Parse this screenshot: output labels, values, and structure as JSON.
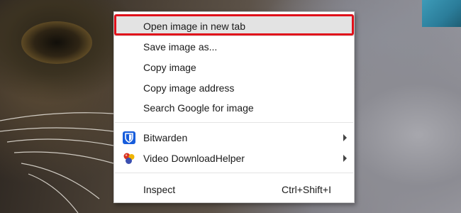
{
  "menu": {
    "items": [
      {
        "label": "Open image in new tab",
        "highlighted": true
      },
      {
        "label": "Save image as..."
      },
      {
        "label": "Copy image"
      },
      {
        "label": "Copy image address"
      },
      {
        "label": "Search Google for image"
      },
      {
        "label": "Bitwarden",
        "icon": "bitwarden-shield-icon",
        "submenu": true
      },
      {
        "label": "Video DownloadHelper",
        "icon": "video-downloadhelper-icon",
        "submenu": true
      },
      {
        "label": "Inspect",
        "shortcut": "Ctrl+Shift+I"
      }
    ]
  },
  "colors": {
    "highlight_border": "#e0101a",
    "highlight_bg": "#e3e3e3",
    "bitwarden_blue": "#175ddc"
  }
}
